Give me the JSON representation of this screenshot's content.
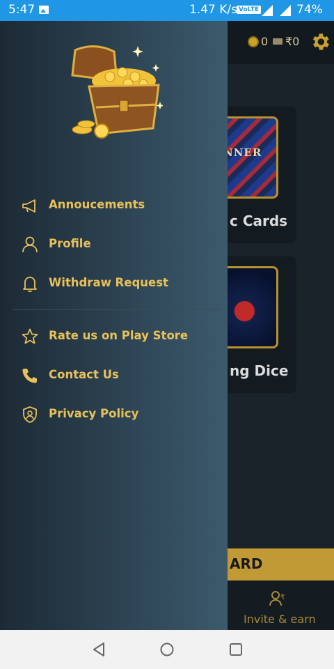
{
  "status_bar": {
    "time": "5:47",
    "network_speed": "1.47 K/s",
    "volte": "VoLTE",
    "battery": "74%"
  },
  "app": {
    "coins": "0",
    "balance": "₹0",
    "games": [
      {
        "label": "c Cards"
      },
      {
        "label": "ng Dice"
      }
    ],
    "card_thumb_text": "NNER",
    "bottom_label": "ARD",
    "invite_label": "Invite & earn"
  },
  "drawer": {
    "menu": [
      {
        "label": "Annoucements",
        "icon": "megaphone-icon"
      },
      {
        "label": "Profile",
        "icon": "person-icon"
      },
      {
        "label": "Withdraw Request",
        "icon": "bell-icon"
      },
      {
        "label": "Rate us on Play Store",
        "icon": "star-icon"
      },
      {
        "label": "Contact Us",
        "icon": "phone-icon"
      },
      {
        "label": "Privacy Policy",
        "icon": "shield-user-icon"
      }
    ]
  },
  "colors": {
    "accent_gold": "#e8c15a",
    "status_bar": "#1f97e6",
    "drawer_dark": "#1d2a35",
    "drawer_light": "#3c5a6c"
  }
}
